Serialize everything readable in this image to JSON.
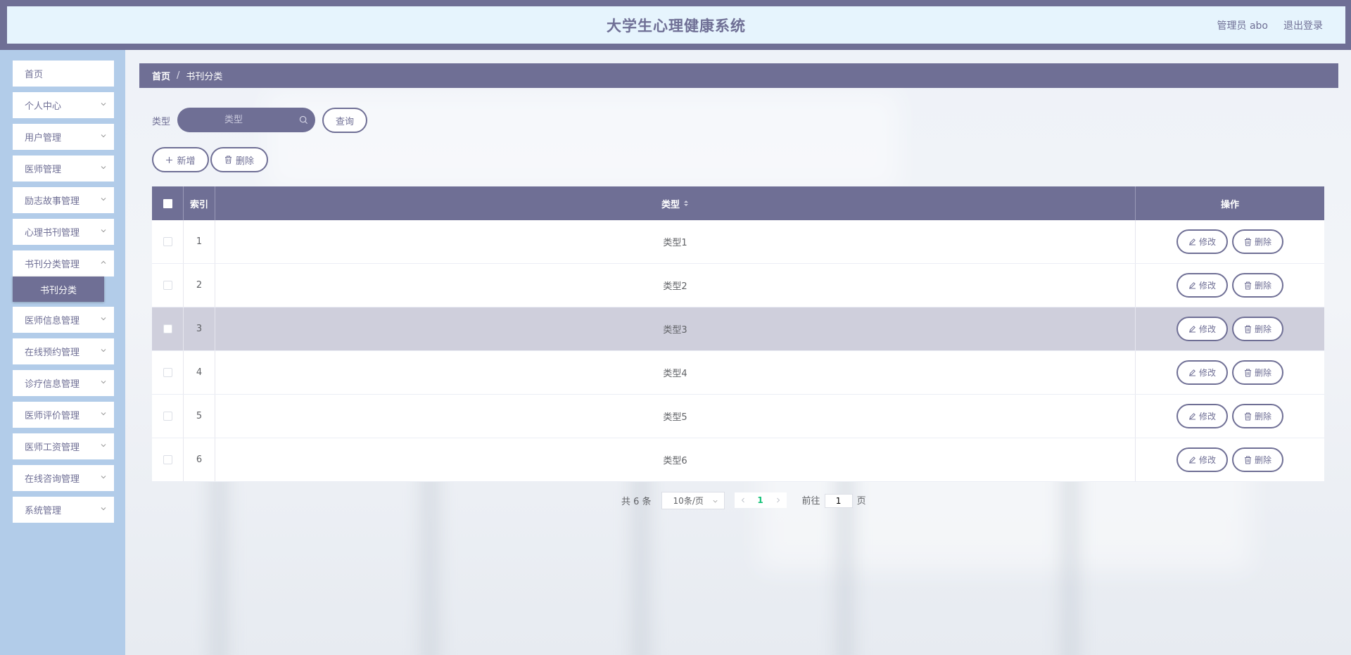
{
  "header": {
    "title": "大学生心理健康系统",
    "user": "管理员 abo",
    "logout": "退出登录"
  },
  "sidebar": {
    "items": [
      {
        "label": "首页",
        "expandable": false
      },
      {
        "label": "个人中心",
        "expandable": true
      },
      {
        "label": "用户管理",
        "expandable": true
      },
      {
        "label": "医师管理",
        "expandable": true
      },
      {
        "label": "励志故事管理",
        "expandable": true
      },
      {
        "label": "心理书刊管理",
        "expandable": true
      },
      {
        "label": "书刊分类管理",
        "expandable": true
      },
      {
        "label": "医师信息管理",
        "expandable": true
      },
      {
        "label": "在线预约管理",
        "expandable": true
      },
      {
        "label": "诊疗信息管理",
        "expandable": true
      },
      {
        "label": "医师评价管理",
        "expandable": true
      },
      {
        "label": "医师工资管理",
        "expandable": true
      },
      {
        "label": "在线咨询管理",
        "expandable": true
      },
      {
        "label": "系统管理",
        "expandable": true
      }
    ],
    "active_sub": "书刊分类"
  },
  "breadcrumb": {
    "home": "首页",
    "separator": "/",
    "current": "书刊分类"
  },
  "search": {
    "label": "类型",
    "placeholder": "类型",
    "query_button": "查询"
  },
  "toolbar": {
    "add_label": "新增",
    "delete_label": "删除"
  },
  "table": {
    "headers": {
      "index": "索引",
      "type": "类型",
      "operation": "操作"
    },
    "rows": [
      {
        "index": "1",
        "type": "类型1"
      },
      {
        "index": "2",
        "type": "类型2"
      },
      {
        "index": "3",
        "type": "类型3"
      },
      {
        "index": "4",
        "type": "类型4"
      },
      {
        "index": "5",
        "type": "类型5"
      },
      {
        "index": "6",
        "type": "类型6"
      }
    ],
    "highlighted_row": 3,
    "edit_label": "修改",
    "delete_label": "删除"
  },
  "pagination": {
    "total": "共 6 条",
    "page_size": "10条/页",
    "current_page": "1",
    "goto_label": "前往",
    "goto_value": "1",
    "page_suffix": "页"
  },
  "colors": {
    "primary": "#6f6f95",
    "sidebar_bg": "#b2cce9",
    "header_bg": "#e6f4fd",
    "highlight_row": "#cfcfdc",
    "page_active": "#13c278"
  }
}
